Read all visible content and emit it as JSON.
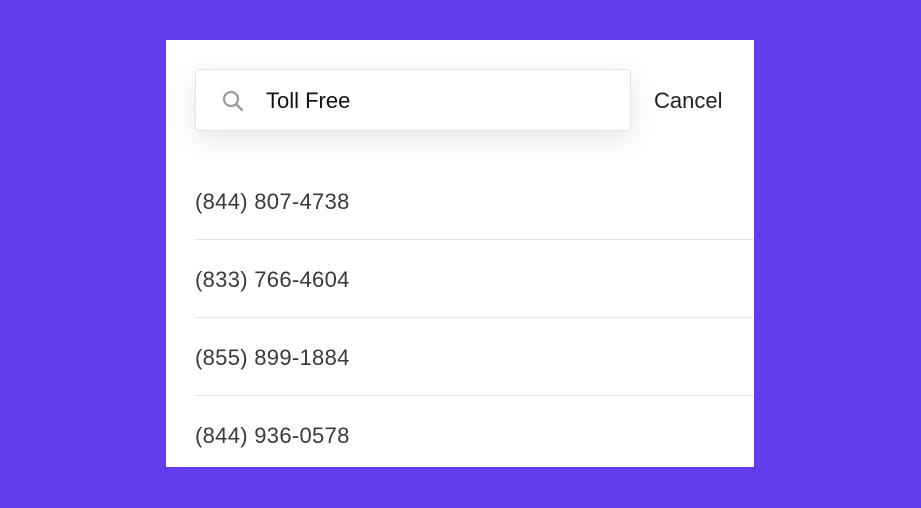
{
  "search": {
    "value": "Toll Free",
    "icon": "search-icon"
  },
  "cancel_label": "Cancel",
  "results": [
    {
      "label": "(844) 807-4738"
    },
    {
      "label": "(833) 766-4604"
    },
    {
      "label": "(855) 899-1884"
    },
    {
      "label": "(844) 936-0578"
    }
  ],
  "colors": {
    "background": "#643cee",
    "panel": "#ffffff",
    "text": "#3a3a3c",
    "icon": "#9a9a9a"
  }
}
